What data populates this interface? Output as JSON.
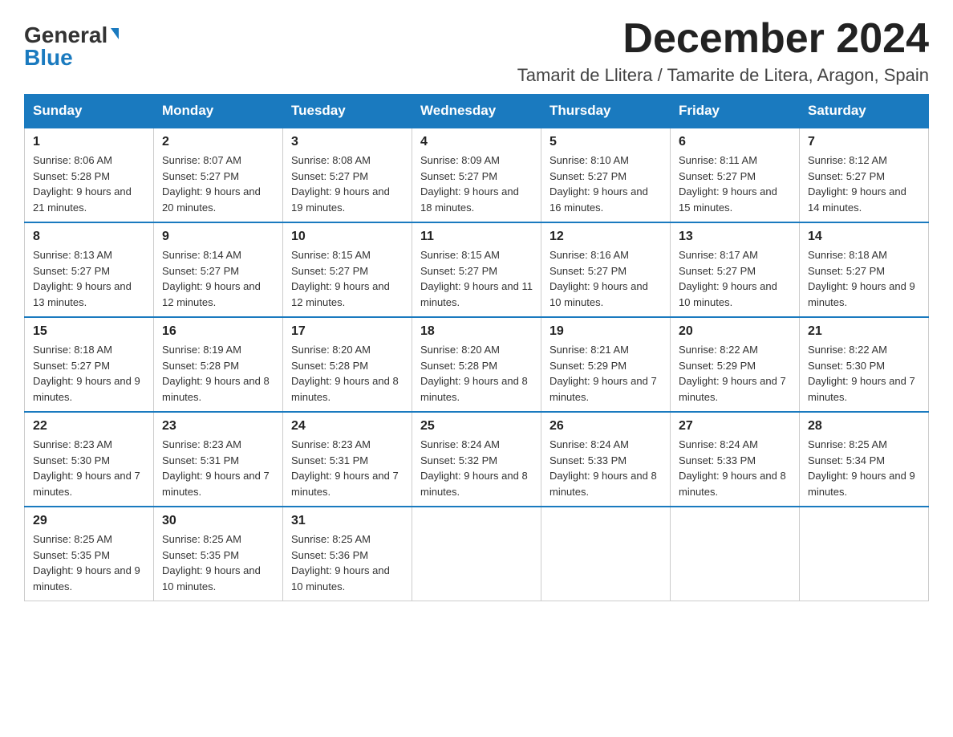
{
  "header": {
    "logo_general": "General",
    "logo_blue": "Blue",
    "month_year": "December 2024",
    "location": "Tamarit de Llitera / Tamarite de Litera, Aragon, Spain"
  },
  "days_of_week": [
    "Sunday",
    "Monday",
    "Tuesday",
    "Wednesday",
    "Thursday",
    "Friday",
    "Saturday"
  ],
  "weeks": [
    [
      {
        "day": "1",
        "sunrise": "8:06 AM",
        "sunset": "5:28 PM",
        "daylight": "9 hours and 21 minutes."
      },
      {
        "day": "2",
        "sunrise": "8:07 AM",
        "sunset": "5:27 PM",
        "daylight": "9 hours and 20 minutes."
      },
      {
        "day": "3",
        "sunrise": "8:08 AM",
        "sunset": "5:27 PM",
        "daylight": "9 hours and 19 minutes."
      },
      {
        "day": "4",
        "sunrise": "8:09 AM",
        "sunset": "5:27 PM",
        "daylight": "9 hours and 18 minutes."
      },
      {
        "day": "5",
        "sunrise": "8:10 AM",
        "sunset": "5:27 PM",
        "daylight": "9 hours and 16 minutes."
      },
      {
        "day": "6",
        "sunrise": "8:11 AM",
        "sunset": "5:27 PM",
        "daylight": "9 hours and 15 minutes."
      },
      {
        "day": "7",
        "sunrise": "8:12 AM",
        "sunset": "5:27 PM",
        "daylight": "9 hours and 14 minutes."
      }
    ],
    [
      {
        "day": "8",
        "sunrise": "8:13 AM",
        "sunset": "5:27 PM",
        "daylight": "9 hours and 13 minutes."
      },
      {
        "day": "9",
        "sunrise": "8:14 AM",
        "sunset": "5:27 PM",
        "daylight": "9 hours and 12 minutes."
      },
      {
        "day": "10",
        "sunrise": "8:15 AM",
        "sunset": "5:27 PM",
        "daylight": "9 hours and 12 minutes."
      },
      {
        "day": "11",
        "sunrise": "8:15 AM",
        "sunset": "5:27 PM",
        "daylight": "9 hours and 11 minutes."
      },
      {
        "day": "12",
        "sunrise": "8:16 AM",
        "sunset": "5:27 PM",
        "daylight": "9 hours and 10 minutes."
      },
      {
        "day": "13",
        "sunrise": "8:17 AM",
        "sunset": "5:27 PM",
        "daylight": "9 hours and 10 minutes."
      },
      {
        "day": "14",
        "sunrise": "8:18 AM",
        "sunset": "5:27 PM",
        "daylight": "9 hours and 9 minutes."
      }
    ],
    [
      {
        "day": "15",
        "sunrise": "8:18 AM",
        "sunset": "5:27 PM",
        "daylight": "9 hours and 9 minutes."
      },
      {
        "day": "16",
        "sunrise": "8:19 AM",
        "sunset": "5:28 PM",
        "daylight": "9 hours and 8 minutes."
      },
      {
        "day": "17",
        "sunrise": "8:20 AM",
        "sunset": "5:28 PM",
        "daylight": "9 hours and 8 minutes."
      },
      {
        "day": "18",
        "sunrise": "8:20 AM",
        "sunset": "5:28 PM",
        "daylight": "9 hours and 8 minutes."
      },
      {
        "day": "19",
        "sunrise": "8:21 AM",
        "sunset": "5:29 PM",
        "daylight": "9 hours and 7 minutes."
      },
      {
        "day": "20",
        "sunrise": "8:22 AM",
        "sunset": "5:29 PM",
        "daylight": "9 hours and 7 minutes."
      },
      {
        "day": "21",
        "sunrise": "8:22 AM",
        "sunset": "5:30 PM",
        "daylight": "9 hours and 7 minutes."
      }
    ],
    [
      {
        "day": "22",
        "sunrise": "8:23 AM",
        "sunset": "5:30 PM",
        "daylight": "9 hours and 7 minutes."
      },
      {
        "day": "23",
        "sunrise": "8:23 AM",
        "sunset": "5:31 PM",
        "daylight": "9 hours and 7 minutes."
      },
      {
        "day": "24",
        "sunrise": "8:23 AM",
        "sunset": "5:31 PM",
        "daylight": "9 hours and 7 minutes."
      },
      {
        "day": "25",
        "sunrise": "8:24 AM",
        "sunset": "5:32 PM",
        "daylight": "9 hours and 8 minutes."
      },
      {
        "day": "26",
        "sunrise": "8:24 AM",
        "sunset": "5:33 PM",
        "daylight": "9 hours and 8 minutes."
      },
      {
        "day": "27",
        "sunrise": "8:24 AM",
        "sunset": "5:33 PM",
        "daylight": "9 hours and 8 minutes."
      },
      {
        "day": "28",
        "sunrise": "8:25 AM",
        "sunset": "5:34 PM",
        "daylight": "9 hours and 9 minutes."
      }
    ],
    [
      {
        "day": "29",
        "sunrise": "8:25 AM",
        "sunset": "5:35 PM",
        "daylight": "9 hours and 9 minutes."
      },
      {
        "day": "30",
        "sunrise": "8:25 AM",
        "sunset": "5:35 PM",
        "daylight": "9 hours and 10 minutes."
      },
      {
        "day": "31",
        "sunrise": "8:25 AM",
        "sunset": "5:36 PM",
        "daylight": "9 hours and 10 minutes."
      },
      null,
      null,
      null,
      null
    ]
  ]
}
